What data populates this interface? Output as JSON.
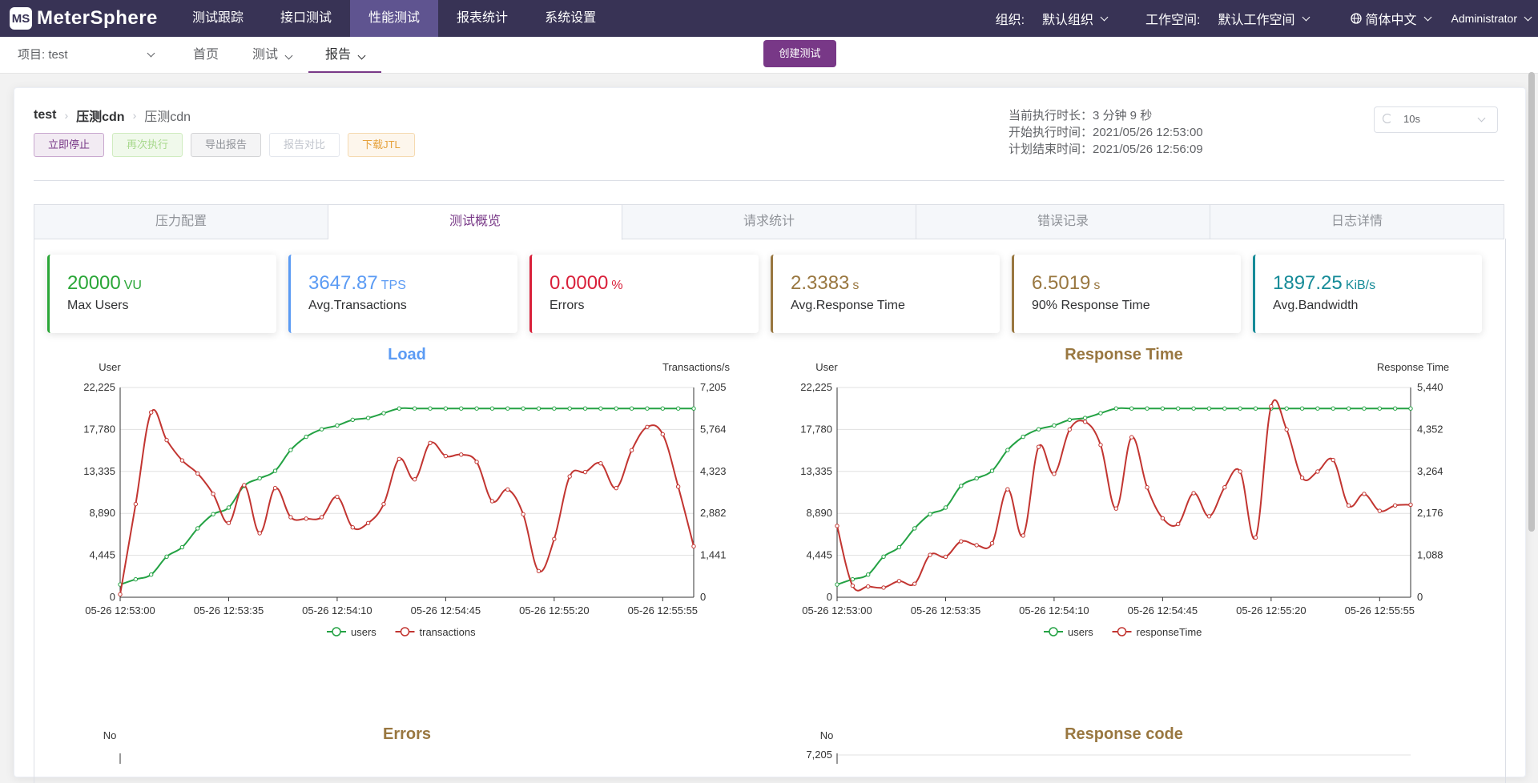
{
  "app": {
    "logo_text": "MeterSphere",
    "logo_mark": "MS"
  },
  "topnav": [
    "测试跟踪",
    "接口测试",
    "性能测试",
    "报表统计",
    "系统设置"
  ],
  "topright": {
    "org_label": "组织:",
    "org_value": "默认组织",
    "ws_label": "工作空间:",
    "ws_value": "默认工作空间",
    "lang": "简体中文",
    "user": "Administrator"
  },
  "subnav": {
    "project": "项目: test",
    "items": [
      "首页",
      "测试",
      "报告"
    ],
    "create_button": "创建测试"
  },
  "breadcrumb": [
    "test",
    "压测cdn",
    "压测cdn"
  ],
  "buttons": {
    "stop": "立即停止",
    "rerun": "再次执行",
    "export": "导出报告",
    "compare": "报告对比",
    "download": "下载JTL"
  },
  "run_info": {
    "duration": "当前执行时长：3 分钟 9 秒",
    "start": "开始执行时间：2021/05/26 12:53:00",
    "end": "计划结束时间：2021/05/26 12:56:09"
  },
  "refresh": "10s",
  "tabs": [
    "压力配置",
    "测试概览",
    "请求统计",
    "错误记录",
    "日志详情"
  ],
  "metrics": [
    {
      "value": "20000",
      "unit": "VU",
      "label": "Max Users",
      "color": "#2aa637"
    },
    {
      "value": "3647.87",
      "unit": "TPS",
      "label": "Avg.Transactions",
      "color": "#5b9bf4"
    },
    {
      "value": "0.0000",
      "unit": "%",
      "label": "Errors",
      "color": "#d9203a"
    },
    {
      "value": "2.3383",
      "unit": "s",
      "label": "Avg.Response Time",
      "color": "#997740"
    },
    {
      "value": "6.5019",
      "unit": "s",
      "label": "90% Response Time",
      "color": "#997740"
    },
    {
      "value": "1897.25",
      "unit": "KiB/s",
      "label": "Avg.Bandwidth",
      "color": "#168b98"
    }
  ],
  "chart_data": [
    {
      "type": "line",
      "title": "Load",
      "title_color": "#5b9bf4",
      "ylabel_left": "User",
      "ylabel_right": "Transactions/s",
      "ylim_left": [
        0,
        22225
      ],
      "ylim_right": [
        0,
        7205
      ],
      "yticks_left": [
        "0",
        "4,445",
        "8,890",
        "13,335",
        "17,780",
        "22,225"
      ],
      "yticks_right": [
        "0",
        "1,441",
        "2,882",
        "4,323",
        "5,764",
        "7,205"
      ],
      "xticks": [
        "05-26 12:53:00",
        "05-26 12:53:35",
        "05-26 12:54:10",
        "05-26 12:54:45",
        "05-26 12:55:20",
        "05-26 12:55:55"
      ],
      "x_count": 38,
      "legend": [
        "users",
        "transactions"
      ],
      "series": [
        {
          "name": "users",
          "axis": "left",
          "color": "#24a244",
          "values": [
            1350,
            1900,
            2400,
            4300,
            5300,
            7300,
            8800,
            9500,
            11800,
            12600,
            13400,
            15600,
            17000,
            17800,
            18200,
            18800,
            19000,
            19500,
            20000,
            20000,
            20000,
            20000,
            20000,
            20000,
            20000,
            20000,
            20000,
            20000,
            20000,
            20000,
            20000,
            20000,
            20000,
            20000,
            20000,
            20000,
            20000,
            20000
          ]
        },
        {
          "name": "transactions",
          "axis": "right",
          "color": "#c23531",
          "values": [
            100,
            3200,
            6350,
            5400,
            4700,
            4250,
            3550,
            2550,
            3850,
            2200,
            3750,
            2750,
            2700,
            2750,
            3450,
            2400,
            2550,
            3200,
            4750,
            4050,
            5300,
            4850,
            4900,
            4650,
            3300,
            3700,
            2850,
            900,
            2000,
            4150,
            4300,
            4600,
            3750,
            5050,
            5850,
            5600,
            3800,
            1750
          ]
        }
      ]
    },
    {
      "type": "line",
      "title": "Response Time",
      "title_color": "#997740",
      "ylabel_left": "User",
      "ylabel_right": "Response Time",
      "ylim_left": [
        0,
        22225
      ],
      "ylim_right": [
        0,
        5440
      ],
      "yticks_left": [
        "0",
        "4,445",
        "8,890",
        "13,335",
        "17,780",
        "22,225"
      ],
      "yticks_right": [
        "0",
        "1,088",
        "2,176",
        "3,264",
        "4,352",
        "5,440"
      ],
      "xticks": [
        "05-26 12:53:00",
        "05-26 12:53:35",
        "05-26 12:54:10",
        "05-26 12:54:45",
        "05-26 12:55:20",
        "05-26 12:55:55"
      ],
      "x_count": 38,
      "legend": [
        "users",
        "responseTime"
      ],
      "series": [
        {
          "name": "users",
          "axis": "left",
          "color": "#24a244",
          "values": [
            1350,
            1900,
            2400,
            4300,
            5300,
            7300,
            8800,
            9500,
            11800,
            12600,
            13400,
            15600,
            17000,
            17800,
            18200,
            18800,
            19000,
            19500,
            20000,
            20000,
            20000,
            20000,
            20000,
            20000,
            20000,
            20000,
            20000,
            20000,
            20000,
            20000,
            20000,
            20000,
            20000,
            20000,
            20000,
            20000,
            20000,
            20000
          ]
        },
        {
          "name": "responseTime",
          "axis": "right",
          "color": "#c23531",
          "values": [
            1850,
            300,
            280,
            250,
            420,
            350,
            1100,
            1050,
            1450,
            1350,
            1400,
            2800,
            1600,
            3900,
            3200,
            4350,
            4550,
            3950,
            2300,
            4150,
            2850,
            2050,
            1900,
            2700,
            2100,
            2850,
            3260,
            1550,
            4950,
            4350,
            3100,
            3260,
            3560,
            2380,
            2680,
            2240,
            2380,
            2400
          ]
        }
      ]
    },
    {
      "type": "line",
      "title": "Errors",
      "title_color": "#997740",
      "ylabel_left": "No"
    },
    {
      "type": "line",
      "title": "Response code",
      "title_color": "#997740",
      "ylabel_left": "No",
      "yticks_left": [
        "7,205"
      ]
    }
  ]
}
